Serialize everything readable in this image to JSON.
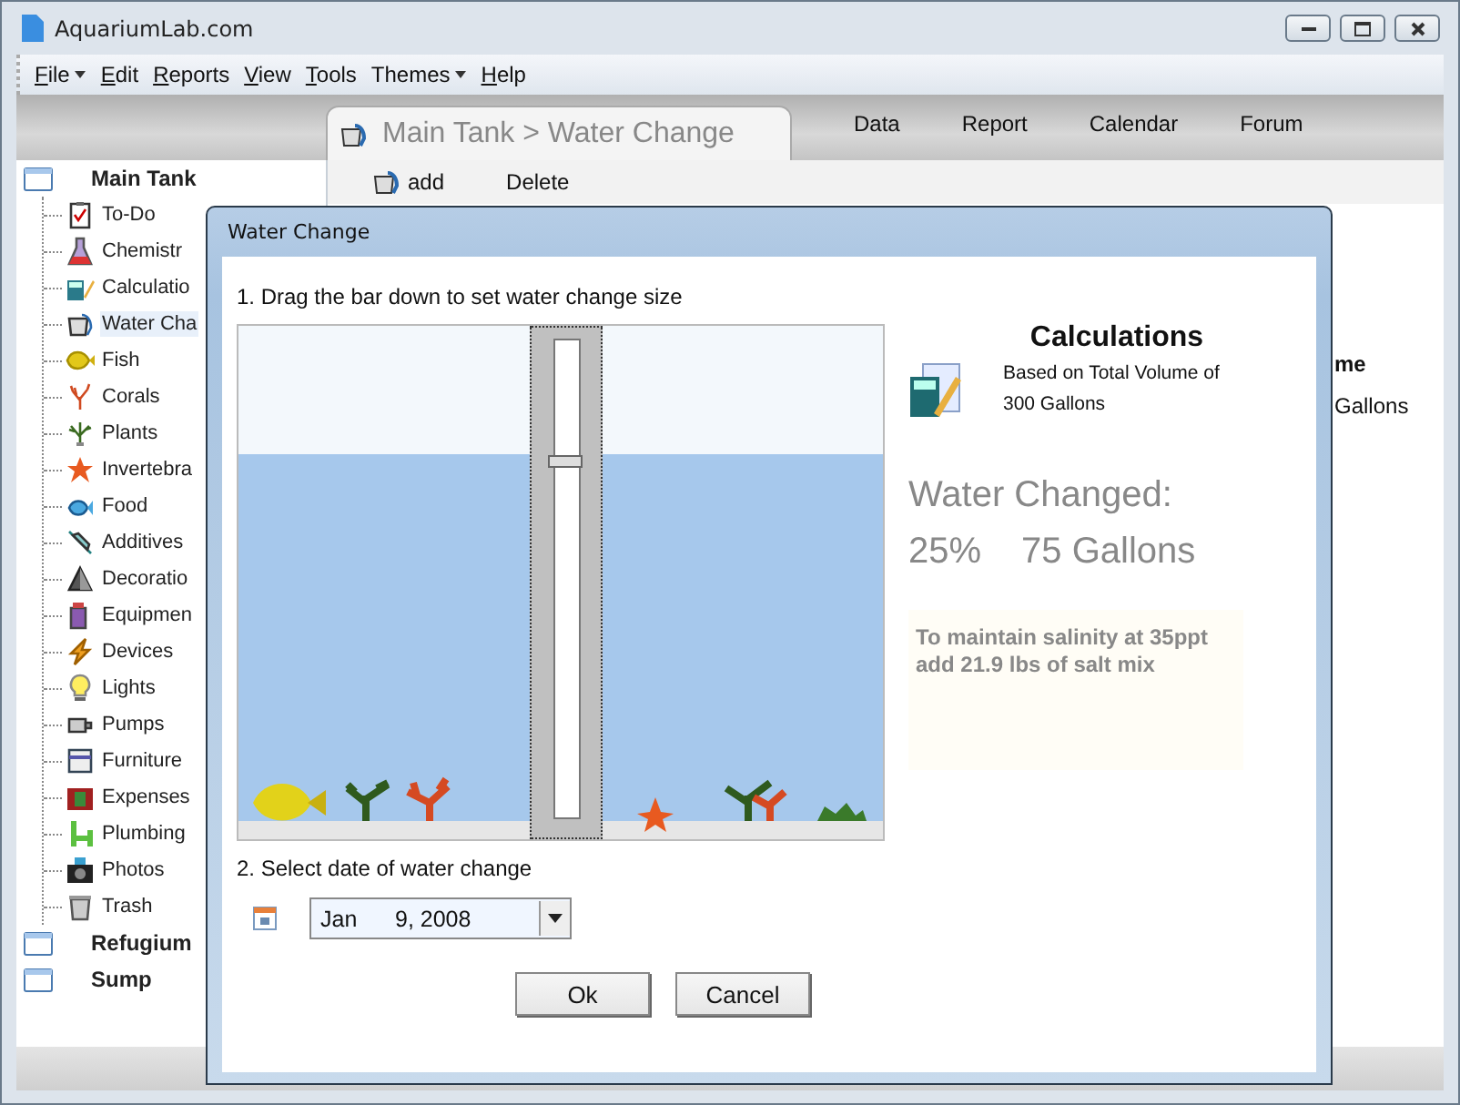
{
  "window": {
    "title": "AquariumLab.com"
  },
  "menu": [
    {
      "label": "File",
      "underline": true,
      "caret": true
    },
    {
      "label": "Edit",
      "underline": true,
      "caret": false
    },
    {
      "label": "Reports",
      "underline": true,
      "caret": false
    },
    {
      "label": "View",
      "underline": true,
      "caret": false
    },
    {
      "label": "Tools",
      "underline": true,
      "caret": false
    },
    {
      "label": "Themes",
      "underline": false,
      "caret": true
    },
    {
      "label": "Help",
      "underline": true,
      "caret": false
    }
  ],
  "tabs": [
    {
      "label": "Main Tank > Water Change",
      "selected": true
    },
    {
      "label": "Data",
      "selected": false
    },
    {
      "label": "Report",
      "selected": false
    },
    {
      "label": "Calendar",
      "selected": false
    },
    {
      "label": "Forum",
      "selected": false
    }
  ],
  "sidebar": {
    "tree": [
      {
        "label": "Main Tank",
        "selected": false,
        "children": [
          {
            "label": "To-Do",
            "selected": false
          },
          {
            "label": "Chemistr",
            "selected": false
          },
          {
            "label": "Calculatio",
            "selected": false
          },
          {
            "label": "Water Cha",
            "selected": true
          },
          {
            "label": "Fish",
            "selected": false
          },
          {
            "label": "Corals",
            "selected": false
          },
          {
            "label": "Plants",
            "selected": false
          },
          {
            "label": "Invertebra",
            "selected": false
          },
          {
            "label": "Food",
            "selected": false
          },
          {
            "label": "Additives",
            "selected": false
          },
          {
            "label": "Decoratio",
            "selected": false
          },
          {
            "label": "Equipmen",
            "selected": false
          },
          {
            "label": "Devices",
            "selected": false
          },
          {
            "label": "Lights",
            "selected": false
          },
          {
            "label": "Pumps",
            "selected": false
          },
          {
            "label": "Furniture",
            "selected": false
          },
          {
            "label": "Expenses",
            "selected": false
          },
          {
            "label": "Plumbing",
            "selected": false
          },
          {
            "label": "Photos",
            "selected": false
          },
          {
            "label": "Trash",
            "selected": false
          }
        ]
      },
      {
        "label": "Refugium",
        "selected": false
      },
      {
        "label": "Sump",
        "selected": false
      }
    ]
  },
  "toolbar": [
    "add",
    "Delete"
  ],
  "background_content": {
    "heading": "me",
    "value": "Gallons"
  },
  "dialog": {
    "title": "Water Change",
    "step1": "1. Drag the bar down to set water change size",
    "calculations": {
      "title": "Calculations",
      "subtitle": "Based on Total Volume of 300 Gallons",
      "result_label": "Water Changed:",
      "percent": "25%",
      "volume": "75 Gallons",
      "note": "To maintain salinity at 35ppt add 21.9 lbs of salt mix"
    },
    "step2": "2. Select date of water change",
    "date": {
      "value": "Jan      9, 2008"
    },
    "buttons": [
      "Ok",
      "Cancel"
    ]
  }
}
